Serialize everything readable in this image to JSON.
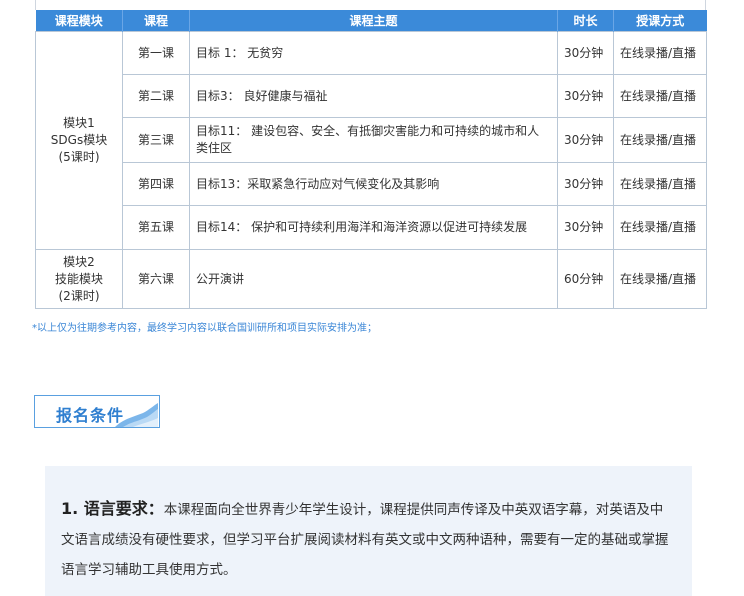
{
  "table": {
    "headers": [
      "课程模块",
      "课程",
      "课程主题",
      "时长",
      "授课方式"
    ],
    "modules": [
      {
        "lines": [
          "模块1",
          "SDGs模块",
          "(5课时)"
        ]
      },
      {
        "lines": [
          "模块2",
          "技能模块",
          "(2课时)"
        ]
      }
    ],
    "rows": [
      {
        "lesson": "第一课",
        "topic": "目标 1： 无贫穷",
        "duration": "30分钟",
        "mode": "在线录播/直播"
      },
      {
        "lesson": "第二课",
        "topic": "目标3： 良好健康与福祉",
        "duration": "30分钟",
        "mode": "在线录播/直播"
      },
      {
        "lesson": "第三课",
        "topic": "目标11： 建设包容、安全、有抵御灾害能力和可持续的城市和人类住区",
        "duration": "30分钟",
        "mode": "在线录播/直播"
      },
      {
        "lesson": "第四课",
        "topic": "目标13：采取紧急行动应对气候变化及其影响",
        "duration": "30分钟",
        "mode": "在线录播/直播"
      },
      {
        "lesson": "第五课",
        "topic": "目标14： 保护和可持续利用海洋和海洋资源以促进可持续发展",
        "duration": "30分钟",
        "mode": "在线录播/直播"
      },
      {
        "lesson": "第六课",
        "topic": "公开演讲",
        "duration": "60分钟",
        "mode": "在线录播/直播"
      }
    ]
  },
  "note": "*以上仅为往期参考内容，最终学习内容以联合国训研所和项目实际安排为准；",
  "section": {
    "title": "报名条件"
  },
  "requirement": {
    "lead": "1. 语言要求：",
    "text": "本课程面向全世界青少年学生设计，课程提供同声传译及中英双语字幕，对英语及中文语言成绩没有硬性要求，但学习平台扩展阅读材料有英文或中文两种语种，需要有一定的基础或掌握语言学习辅助工具使用方式。"
  },
  "colors": {
    "accent": "#3b8ad9",
    "panel": "#eef3fa"
  }
}
